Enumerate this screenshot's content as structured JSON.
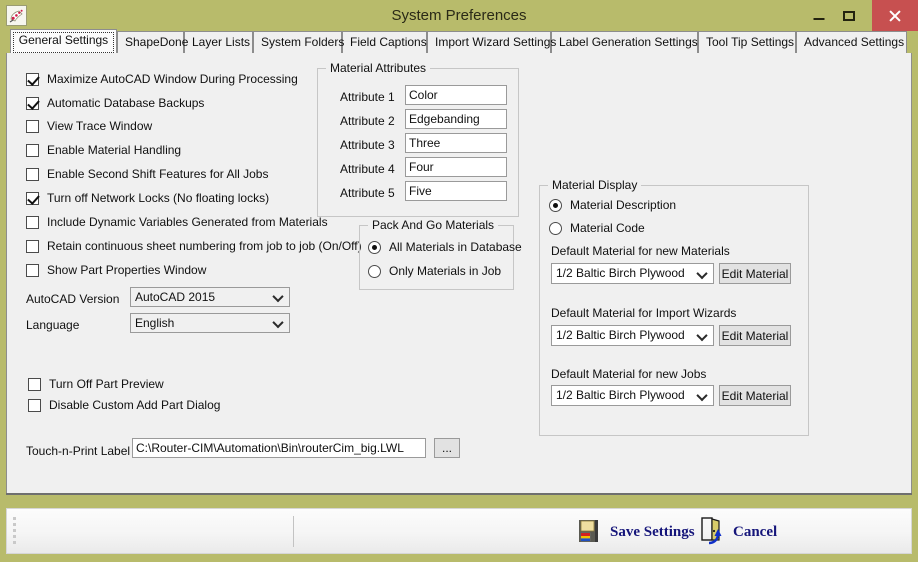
{
  "window": {
    "title": "System Preferences",
    "app_icon": "router-cim-icon",
    "controls": {
      "minimize": "minimize-icon",
      "maximize": "maximize-icon",
      "close": "close-icon"
    },
    "colors": {
      "titlebar": "#b8bb6b",
      "close_button": "#c75050",
      "content": "#f0f0f0",
      "footer_text": "#15157a"
    }
  },
  "tabs": [
    {
      "label": "General Settings",
      "selected": true
    },
    {
      "label": "ShapeDone",
      "selected": false
    },
    {
      "label": "Layer Lists",
      "selected": false
    },
    {
      "label": "System Folders",
      "selected": false
    },
    {
      "label": "Field Captions",
      "selected": false
    },
    {
      "label": "Import Wizard Settings",
      "selected": false
    },
    {
      "label": "Label Generation Settings",
      "selected": false
    },
    {
      "label": "Tool Tip Settings",
      "selected": false
    },
    {
      "label": "Advanced Settings",
      "selected": false
    }
  ],
  "general": {
    "checkboxes": [
      {
        "label": "Maximize AutoCAD Window During Processing",
        "checked": true
      },
      {
        "label": "Automatic Database Backups",
        "checked": true
      },
      {
        "label": "View Trace Window",
        "checked": false
      },
      {
        "label": "Enable Material Handling",
        "checked": false
      },
      {
        "label": "Enable Second Shift Features for All Jobs",
        "checked": false
      },
      {
        "label": "Turn off Network Locks (No floating locks)",
        "checked": true
      },
      {
        "label": "Include Dynamic Variables Generated from Materials",
        "checked": false
      },
      {
        "label": "Retain continuous sheet numbering from job to job (On/Off)",
        "checked": false
      },
      {
        "label": "Show Part Properties Window",
        "checked": false
      }
    ],
    "autocad_version": {
      "label": "AutoCAD Version",
      "value": "AutoCAD 2015"
    },
    "language": {
      "label": "Language",
      "value": "English"
    },
    "lower_checkboxes": [
      {
        "label": "Turn Off Part Preview",
        "checked": false
      },
      {
        "label": "Disable Custom Add Part Dialog",
        "checked": false
      }
    ],
    "touch_n_print": {
      "label": "Touch-n-Print Label",
      "value": "C:\\Router-CIM\\Automation\\Bin\\routerCim_big.LWL",
      "browse_label": "..."
    }
  },
  "material_attributes": {
    "title": "Material Attributes",
    "rows": [
      {
        "label": "Attribute 1",
        "value": "Color"
      },
      {
        "label": "Attribute 2",
        "value": "Edgebanding"
      },
      {
        "label": "Attribute 3",
        "value": "Three"
      },
      {
        "label": "Attribute 4",
        "value": "Four"
      },
      {
        "label": "Attribute 5",
        "value": "Five"
      }
    ]
  },
  "pack_and_go": {
    "title": "Pack And Go Materials",
    "options": [
      {
        "label": "All Materials in Database",
        "selected": true
      },
      {
        "label": "Only Materials in Job",
        "selected": false
      }
    ]
  },
  "material_display": {
    "title": "Material Display",
    "options": [
      {
        "label": "Material Description",
        "selected": true
      },
      {
        "label": "Material Code",
        "selected": false
      }
    ],
    "defaults": [
      {
        "label": "Default Material for new Materials",
        "value": "1/2 Baltic Birch Plywood",
        "button": "Edit Material"
      },
      {
        "label": "Default Material for Import Wizards",
        "value": "1/2 Baltic Birch Plywood",
        "button": "Edit Material"
      },
      {
        "label": "Default Material for new Jobs",
        "value": "1/2 Baltic Birch Plywood",
        "button": "Edit Material"
      }
    ]
  },
  "footer": {
    "save_label": "Save Settings",
    "save_icon": "floppy-disk-icon",
    "cancel_label": "Cancel",
    "cancel_icon": "exit-door-icon"
  }
}
